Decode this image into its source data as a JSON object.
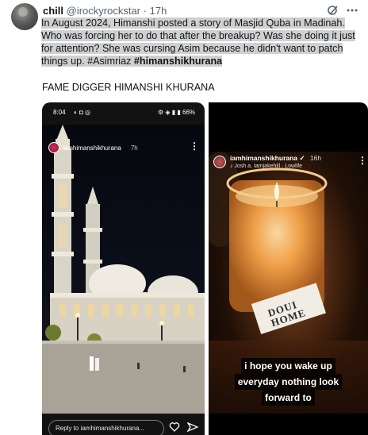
{
  "tweet": {
    "display_name": "chill",
    "handle": "@irockyrockstar",
    "separator": "·",
    "time": "17h",
    "text_part1": "In August 2024, Himanshi posted a story of Masjid Quba in Madinah. Who was forcing her to do that after the breakup? Was she doing it just for attention? She was cursing Asim because he didn't want to patch things up. #Asimriaz ",
    "text_part2": "#himanshikhurana",
    "tagline": "FAME DIGGER HIMANSHI KHURANA",
    "header_icons": [
      "grok-icon",
      "more-icon"
    ]
  },
  "story_left": {
    "status_time": "8:04",
    "status_left_icons": "◐ ◘ ◎",
    "status_right": "⚙ ◈ ▮ ▮ 66%",
    "username": "iamhimanshikhurana",
    "age": "7h",
    "more": "⋮",
    "reply_placeholder": "Reply to iamhimanshikhurana...",
    "action_icons": [
      "heart-icon",
      "send-icon"
    ]
  },
  "story_right": {
    "username": "iamhimanshikhurana",
    "verified": "✓",
    "age": "16h",
    "music": "♪ Josh a, Iamjakehill · Lowlife",
    "more": "⋮",
    "candle_label_1": "DOUI",
    "candle_label_2": "HOME",
    "caption_line1": "i hope you wake up",
    "caption_line2": "everyday nothing look",
    "caption_line3": "forward to"
  },
  "colors": {
    "text": "#0f1419",
    "muted": "#536471",
    "highlight": "#d0d0d0",
    "story_bg": "#121212",
    "candle_glow": "#f7a54a"
  }
}
